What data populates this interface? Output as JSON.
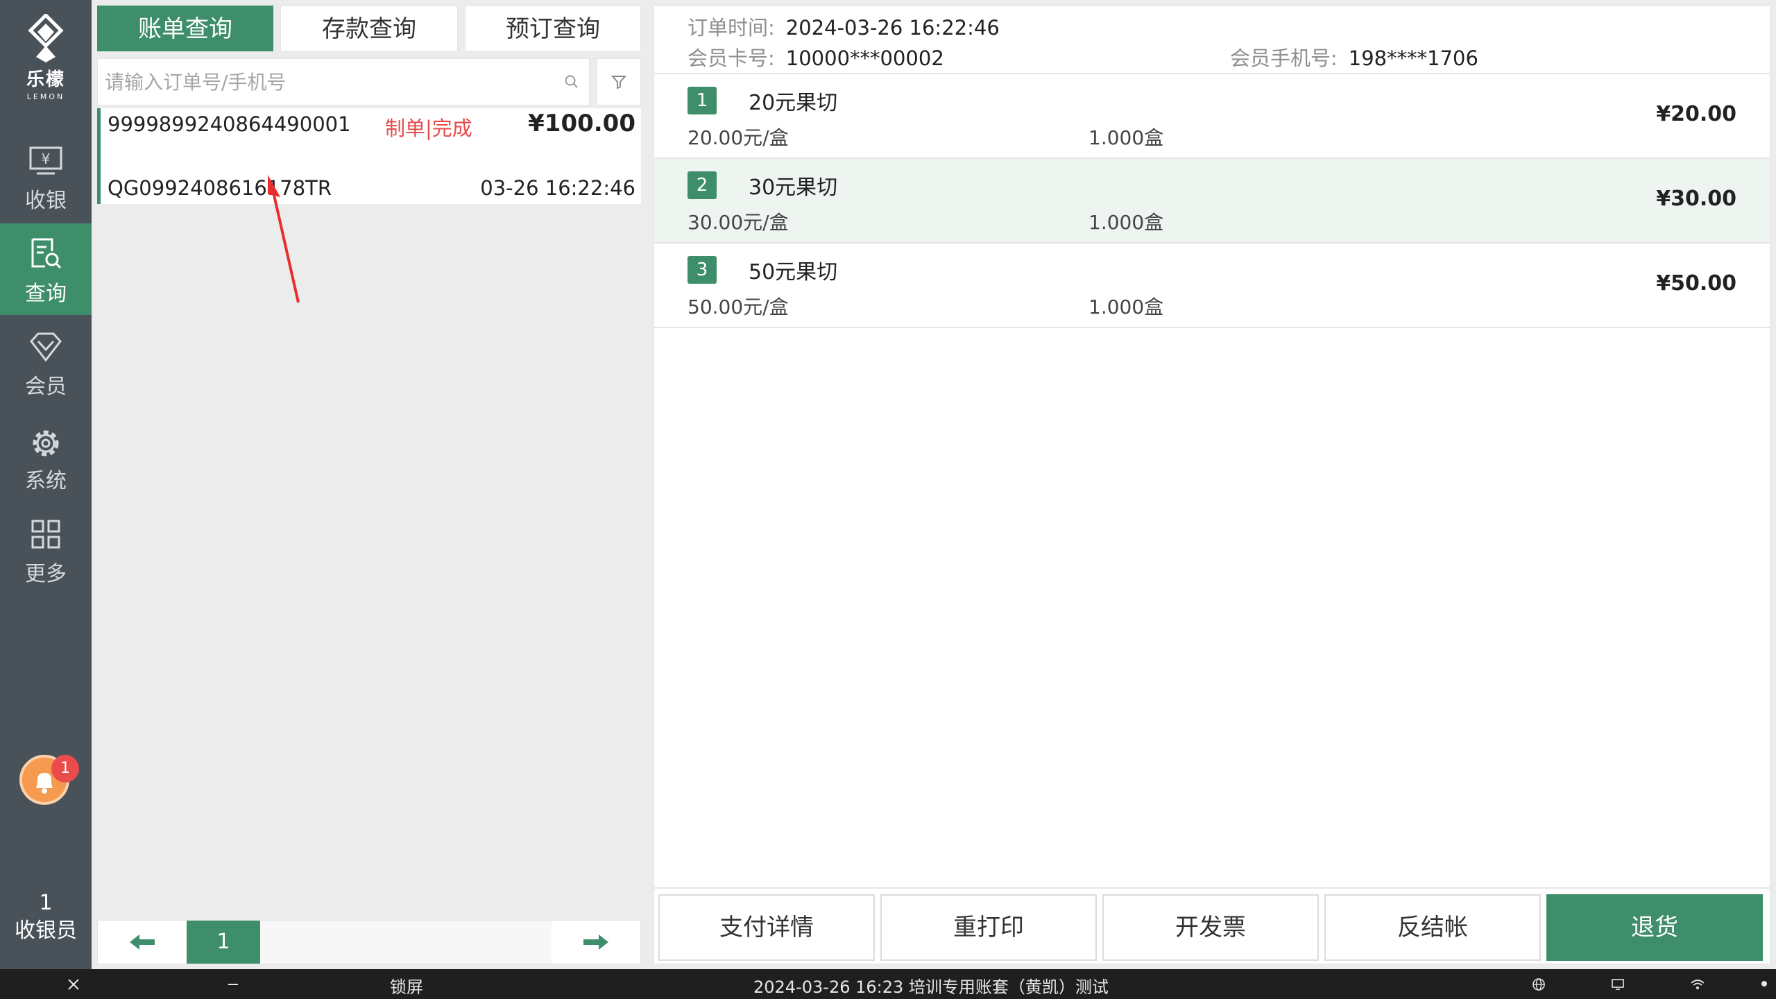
{
  "sidebar": {
    "brand": "乐檬",
    "brand_en": "LEMON",
    "items": [
      {
        "label": "收银",
        "icon": "cash-register-icon"
      },
      {
        "label": "查询",
        "icon": "search-document-icon",
        "active": true
      },
      {
        "label": "会员",
        "icon": "diamond-icon"
      },
      {
        "label": "系统",
        "icon": "gear-icon"
      },
      {
        "label": "更多",
        "icon": "grid-icon"
      }
    ],
    "notification_count": "1",
    "cashier_no": "1",
    "cashier_label": "收银员"
  },
  "tabs": [
    {
      "label": "账单查询",
      "active": true
    },
    {
      "label": "存款查询"
    },
    {
      "label": "预订查询"
    }
  ],
  "search": {
    "placeholder": "请输入订单号/手机号",
    "value": ""
  },
  "order": {
    "order_no": "9999899240864490001",
    "status": "制单|完成",
    "amount": "¥100.00",
    "code": "QG0992408616178TR",
    "time": "03-26 16:22:46"
  },
  "pager": {
    "page": "1"
  },
  "detail": {
    "order_time_label": "订单时间:",
    "order_time": "2024-03-26 16:22:46",
    "card_label": "会员卡号:",
    "card_no": "10000***00002",
    "phone_label": "会员手机号:",
    "phone": "198****1706",
    "items": [
      {
        "no": "1",
        "name": "20元果切",
        "unit_price": "20.00元/盒",
        "qty": "1.000盒",
        "amount": "¥20.00"
      },
      {
        "no": "2",
        "name": "30元果切",
        "unit_price": "30.00元/盒",
        "qty": "1.000盒",
        "amount": "¥30.00"
      },
      {
        "no": "3",
        "name": "50元果切",
        "unit_price": "50.00元/盒",
        "qty": "1.000盒",
        "amount": "¥50.00"
      }
    ]
  },
  "actions": {
    "pay_detail": "支付详情",
    "reprint": "重打印",
    "invoice": "开发票",
    "reverse": "反结帐",
    "refund": "退货"
  },
  "taskbar": {
    "lock": "锁屏",
    "status": "2024-03-26 16:23 培训专用账套（黄凯）测试"
  },
  "colors": {
    "accent": "#3f8e6b",
    "sidebar": "#4a5259",
    "alert": "#e84a4a"
  }
}
